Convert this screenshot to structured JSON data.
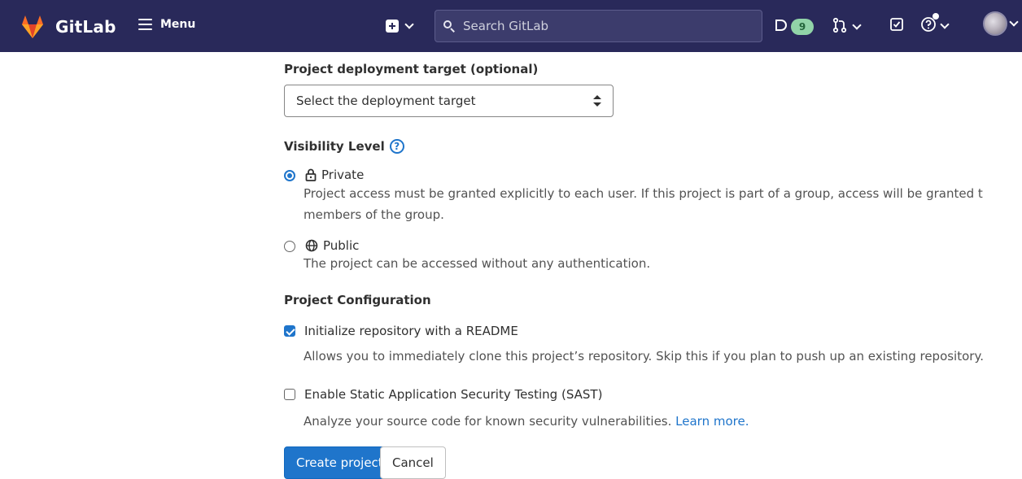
{
  "header": {
    "brand_name": "GitLab",
    "menu_label": "Menu",
    "search_placeholder": "Search GitLab",
    "issues_count": "9",
    "colors": {
      "background": "#29295a",
      "badge": "#91d4a8"
    }
  },
  "form": {
    "deployment": {
      "label": "Project deployment target (optional)",
      "select_value": "Select the deployment target"
    },
    "visibility": {
      "title": "Visibility Level",
      "help_icon": "?",
      "options": [
        {
          "label": "Private",
          "checked": true,
          "icon": "lock-icon",
          "desc_line1": "Project access must be granted explicitly to each user. If this project is part of a group, access will be granted t",
          "desc_line2": "members of the group."
        },
        {
          "label": "Public",
          "checked": false,
          "icon": "globe-icon",
          "desc_line1": "The project can be accessed without any authentication."
        }
      ]
    },
    "configuration": {
      "title": "Project Configuration",
      "readme": {
        "label": "Initialize repository with a README",
        "checked": true,
        "desc": "Allows you to immediately clone this project’s repository. Skip this if you plan to push up an existing repository."
      },
      "sast": {
        "label": "Enable Static Application Security Testing (SAST)",
        "checked": false,
        "desc": "Analyze your source code for known security vulnerabilities.",
        "link": "Learn more."
      }
    },
    "buttons": {
      "create": "Create project",
      "cancel": "Cancel"
    },
    "accent_color": "#1f75cb"
  }
}
